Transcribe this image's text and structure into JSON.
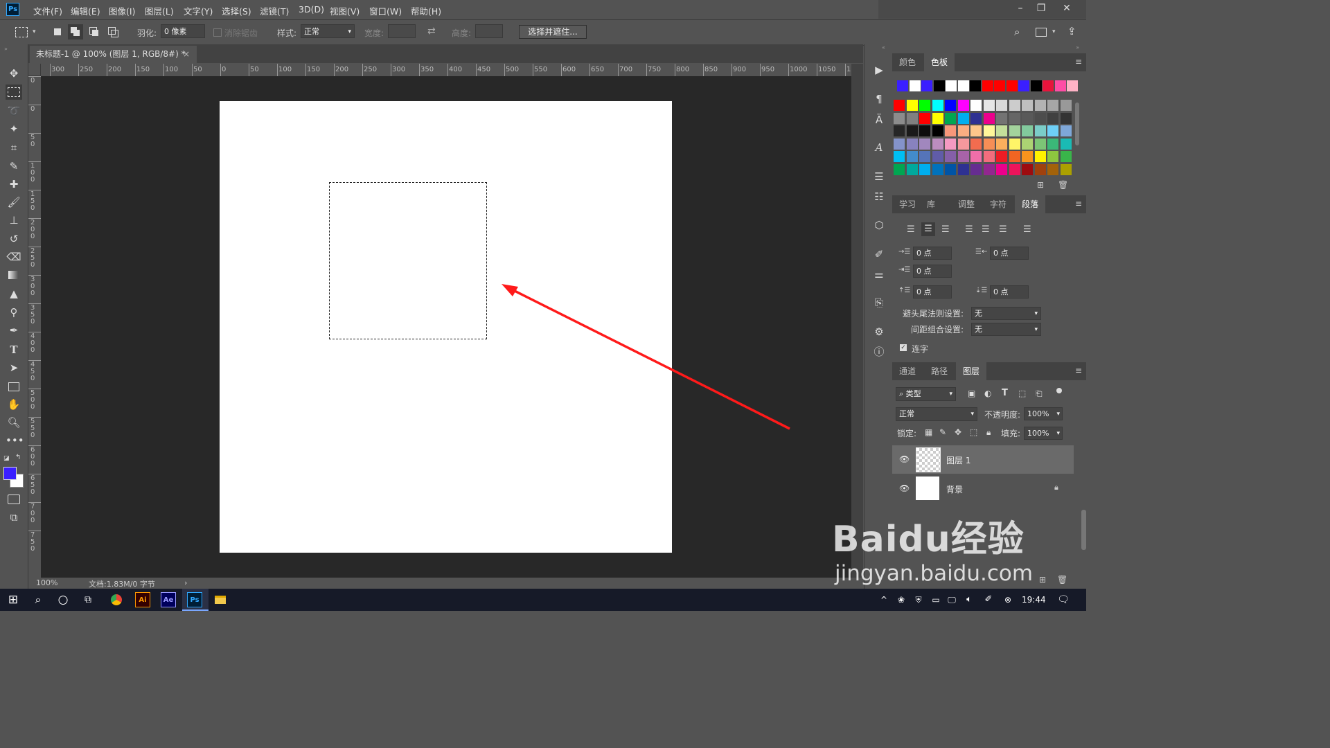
{
  "app": {
    "logo": "Ps"
  },
  "menu": [
    "文件(F)",
    "编辑(E)",
    "图像(I)",
    "图层(L)",
    "文字(Y)",
    "选择(S)",
    "滤镜(T)",
    "3D(D)",
    "视图(V)",
    "窗口(W)",
    "帮助(H)"
  ],
  "window_controls": {
    "minimize": "–",
    "restore": "❐",
    "close": "✕"
  },
  "options": {
    "feather_label": "羽化:",
    "feather_value": "0 像素",
    "antialias_label": "消除锯齿",
    "style_label": "样式:",
    "style_value": "正常",
    "width_label": "宽度:",
    "height_label": "高度:",
    "select_mask_button": "选择并遮住..."
  },
  "document": {
    "tab_title": "未标题-1 @ 100% (图层 1, RGB/8#) *",
    "zoom": "100%",
    "doc_info": "文档:1.83M/0 字节"
  },
  "ruler": {
    "h_ticks": [
      "300",
      "250",
      "200",
      "150",
      "100",
      "50",
      "0",
      "50",
      "100",
      "150",
      "200",
      "250",
      "300",
      "350",
      "400",
      "450",
      "500",
      "550",
      "600",
      "650",
      "700",
      "750",
      "800",
      "850",
      "900",
      "950",
      "1000",
      "1050",
      "11"
    ],
    "v_ticks": [
      "0",
      "0",
      "5 0",
      "1 0 0",
      "1 5 0",
      "2 0 0",
      "2 5 0",
      "3 0 0",
      "3 5 0",
      "4 0 0",
      "4 5 0",
      "5 0 0",
      "5 5 0",
      "6 0 0",
      "6 5 0",
      "7 0 0",
      "7 5 0"
    ]
  },
  "swatches_top_row": [
    "#3a1fff",
    "#ffffff",
    "#3a1fff",
    "#000000",
    "#ffffff",
    "#ffffff",
    "#000000",
    "#ff0000",
    "#ff0000",
    "#ff0000",
    "#3a1fff",
    "#000000",
    "#e8143c",
    "#ff4da6",
    "#ffb3c6"
  ],
  "swatches_grid": [
    [
      "#ff0000",
      "#ffff00",
      "#00ff00",
      "#00ffff",
      "#0000ff",
      "#ff00ff",
      "#ffffff",
      "#e6e6e6",
      "#d9d9d9",
      "#cccccc",
      "#bfbfbf",
      "#b3b3b3",
      "#a6a6a6",
      "#999999"
    ],
    [
      "#8c8c8c",
      "#808080",
      "#ff0000",
      "#ffff00",
      "#00a651",
      "#00aeef",
      "#2e3192",
      "#ec008c",
      "#737373",
      "#666666",
      "#595959",
      "#4d4d4d",
      "#404040",
      "#333333"
    ],
    [
      "#262626",
      "#1a1a1a",
      "#0d0d0d",
      "#000000",
      "#f7977a",
      "#f9ad81",
      "#fdc68a",
      "#fff79a",
      "#c4df9b",
      "#a3d39c",
      "#82ca9d",
      "#7bcdc8",
      "#6ecff6",
      "#7ea7d8"
    ],
    [
      "#8493ca",
      "#8882be",
      "#a187be",
      "#bc8dbf",
      "#f49ac2",
      "#f6989d",
      "#f26c4f",
      "#f68e56",
      "#fbaf5d",
      "#fff568",
      "#acd373",
      "#7cc576",
      "#3bb878",
      "#1abbb4"
    ],
    [
      "#00bff3",
      "#438ccb",
      "#5574b9",
      "#605ca8",
      "#855fa8",
      "#a763a8",
      "#f06ea9",
      "#f26d7d",
      "#ed1c24",
      "#f26522",
      "#f7941d",
      "#fff200",
      "#8dc63f",
      "#39b54a"
    ],
    [
      "#00a651",
      "#00a99d",
      "#00aeef",
      "#0072bc",
      "#0054a6",
      "#2e3192",
      "#662d91",
      "#92278f",
      "#ec008c",
      "#ed145b",
      "#9e0b0f",
      "#a0410d",
      "#a36209",
      "#aba000"
    ]
  ],
  "panel_tabs_color": [
    "颜色",
    "色板"
  ],
  "panel_tabs_para": [
    "学习",
    "库",
    "调整",
    "字符",
    "段落"
  ],
  "paragraph": {
    "indent_left": "0 点",
    "indent_right": "0 点",
    "indent_first": "0 点",
    "space_before": "0 点",
    "space_after": "0 点",
    "kinsoku_label": "避头尾法则设置:",
    "kinsoku_value": "无",
    "mojikumi_label": "间距组合设置:",
    "mojikumi_value": "无",
    "hyphenate_label": "连字"
  },
  "panel_tabs_layers": [
    "通道",
    "路径",
    "图层"
  ],
  "layers_panel": {
    "filter_value": "类型",
    "blend_mode": "正常",
    "opacity_label": "不透明度:",
    "opacity_value": "100%",
    "lock_label": "锁定:",
    "fill_label": "填充:",
    "fill_value": "100%",
    "layers": [
      {
        "name": "图层 1"
      },
      {
        "name": "背景"
      }
    ]
  },
  "watermark": {
    "brand": "Baidu经验",
    "url": "jingyan.baidu.com"
  },
  "taskbar": {
    "time": "19:44"
  },
  "colors": {
    "foreground": "#3a1fff",
    "background": "#ffffff",
    "arrow": "#ff1a1a"
  }
}
